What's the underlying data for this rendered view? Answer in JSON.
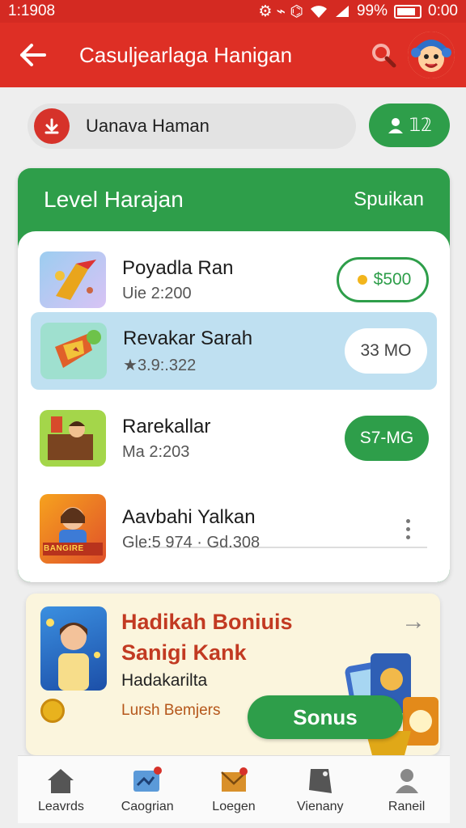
{
  "status": {
    "time": "1:1908",
    "icons": "⚙ ⌁ ⌬",
    "battery": "99%",
    "clock": "0:00"
  },
  "appbar": {
    "title": "Casuljearlaga Hanigan"
  },
  "search": {
    "text": "Uanava Haman"
  },
  "friends": {
    "label": "𝟙𝟚"
  },
  "level": {
    "title": "Level Harajan",
    "link": "Spuikan",
    "rows": [
      {
        "name": "Poyadla Ran",
        "sub": "Uie 2:200",
        "action": "$500"
      },
      {
        "name": "Revakar Sarah",
        "sub": "3.9:.322",
        "action": "33 MO"
      },
      {
        "name": "Rarekallar",
        "sub": "Ma 2:203",
        "action": "S7-MG"
      },
      {
        "name": "Aavbahi Yalkan",
        "sub": "Gle:5 974 · Gd.308",
        "action": ""
      }
    ],
    "row4_banner": "BANGIRE"
  },
  "bonus": {
    "title_line1": "Hadikah Boniuis",
    "title_line2": "Sanigi Kank",
    "desc": "Hadakarilta",
    "sub": "Lursh Bemjers",
    "button": "Sonus"
  },
  "nav": [
    {
      "label": "Leavrds",
      "icon": "home-icon"
    },
    {
      "label": "Caogrian",
      "icon": "gallery-icon"
    },
    {
      "label": "Loegen",
      "icon": "mail-icon"
    },
    {
      "label": "Vienany",
      "icon": "tag-icon"
    },
    {
      "label": "Raneil",
      "icon": "profile-icon"
    }
  ],
  "colors": {
    "red": "#de2f25",
    "green": "#2e9e4a",
    "selected_row": "#bfe0f1",
    "bonus_bg": "#fbf5dd"
  }
}
